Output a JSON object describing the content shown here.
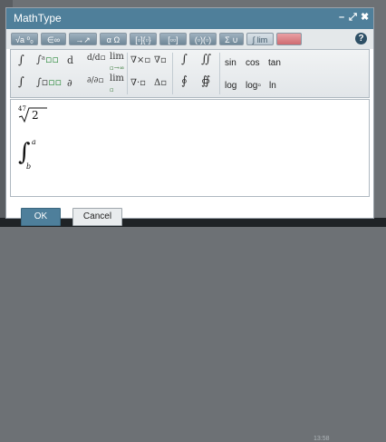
{
  "window": {
    "title": "MathType"
  },
  "controls": {
    "minimize": "–",
    "maximize": "⤢",
    "close": "✖"
  },
  "tabs": [
    {
      "label": "√a ⁰₀"
    },
    {
      "label": "∈∞"
    },
    {
      "label": "→↗"
    },
    {
      "label": "α Ω"
    },
    {
      "label": "[▫]{▫}"
    },
    {
      "label": "[▫▫]"
    },
    {
      "label": "(▫)(▫)"
    },
    {
      "label": "Σ ∪"
    },
    {
      "label": "∫ lim"
    },
    {
      "label": ""
    }
  ],
  "help": "?",
  "palette": {
    "row1": [
      "∫",
      "∫ᵃ",
      "d",
      "d/d▫",
      "lim",
      "∇×▫",
      "∇▫",
      "∫",
      "∬"
    ],
    "row1_sub": {
      "lim_to": "▫→∞",
      "int_bound": "▫",
      "int_ab_lo": "▫",
      "int_ab_hi": "a"
    },
    "row2": [
      "∫",
      "∫▫",
      "∂",
      "∂/∂▫",
      "lim",
      "∇·▫",
      "Δ▫",
      "∮",
      "∯"
    ],
    "row2_sub": {
      "lim_under": "▫"
    },
    "functions_row1": [
      "sin",
      "cos",
      "tan"
    ],
    "functions_row2": [
      "log",
      "log▫",
      "ln"
    ]
  },
  "editor": {
    "root_index": "47",
    "root_radicand": "2",
    "integral_upper": "a",
    "integral_lower": "b"
  },
  "buttons": {
    "ok": "OK",
    "cancel": "Cancel"
  },
  "taskbar": {
    "clock": "13:58"
  }
}
